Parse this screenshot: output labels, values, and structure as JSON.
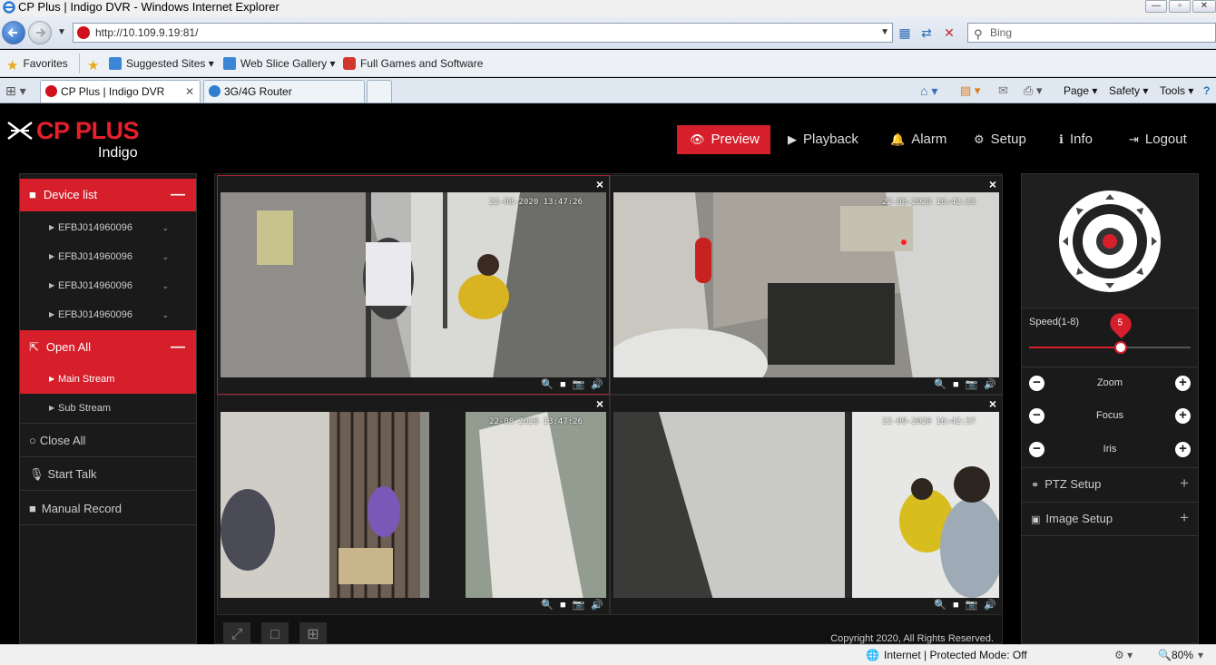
{
  "window": {
    "title": "CP Plus | Indigo DVR - Windows Internet Explorer",
    "minimize": "—",
    "restore": "▫",
    "close": "✕"
  },
  "browser": {
    "address": "http://10.109.9.19:81/",
    "search_placeholder": "Bing",
    "favorites_label": "Favorites",
    "favorites": [
      "Suggested Sites ▾",
      "Web Slice Gallery ▾",
      "Full Games and Software"
    ],
    "tabs": [
      {
        "label": "CP Plus | Indigo DVR",
        "active": true
      },
      {
        "label": "3G/4G Router",
        "active": false
      }
    ],
    "commands": [
      "Page ▾",
      "Safety ▾",
      "Tools ▾"
    ],
    "status": {
      "zone": "Internet | Protected Mode: Off",
      "zoom": "80%"
    }
  },
  "app": {
    "brand": "CP PLUS",
    "brand_sub": "Indigo",
    "nav": [
      {
        "label": "Preview",
        "icon": "eye-icon",
        "active": true
      },
      {
        "label": "Playback",
        "icon": "play-icon",
        "active": false
      },
      {
        "label": "Alarm",
        "icon": "bell-icon",
        "active": false
      },
      {
        "label": "Setup",
        "icon": "gear-icon",
        "active": false
      },
      {
        "label": "Info",
        "icon": "info-icon",
        "active": false
      },
      {
        "label": "Logout",
        "icon": "logout-icon",
        "active": false
      }
    ],
    "left": {
      "device_list": "Device list",
      "devices": [
        "EFBJ014960096",
        "EFBJ014960096",
        "EFBJ014960096",
        "EFBJ014960096"
      ],
      "open_all": "Open All",
      "streams": [
        "Main Stream",
        "Sub Stream"
      ],
      "close_all": "Close All",
      "start_talk": "Start Talk",
      "manual_record": "Manual Record"
    },
    "cameras": [
      {
        "timestamp": "22-08-2020  13:47:26",
        "selected": true
      },
      {
        "timestamp": "22-08-2020  16:42:33",
        "selected": false
      },
      {
        "timestamp": "22-08-2020  13:47:26",
        "selected": false
      },
      {
        "timestamp": "22-09-2020  16:42:37",
        "selected": false
      }
    ],
    "copyright": "Copyright 2020, All Rights Reserved.",
    "ptz": {
      "speed_label": "Speed(1-8)",
      "speed_value": "5",
      "speed_min": 1,
      "speed_max": 8,
      "zoom": "Zoom",
      "focus": "Focus",
      "iris": "Iris",
      "ptz_setup": "PTZ Setup",
      "image_setup": "Image Setup"
    },
    "colors": {
      "accent": "#d61f2b",
      "panel": "#1a1a1a"
    }
  }
}
